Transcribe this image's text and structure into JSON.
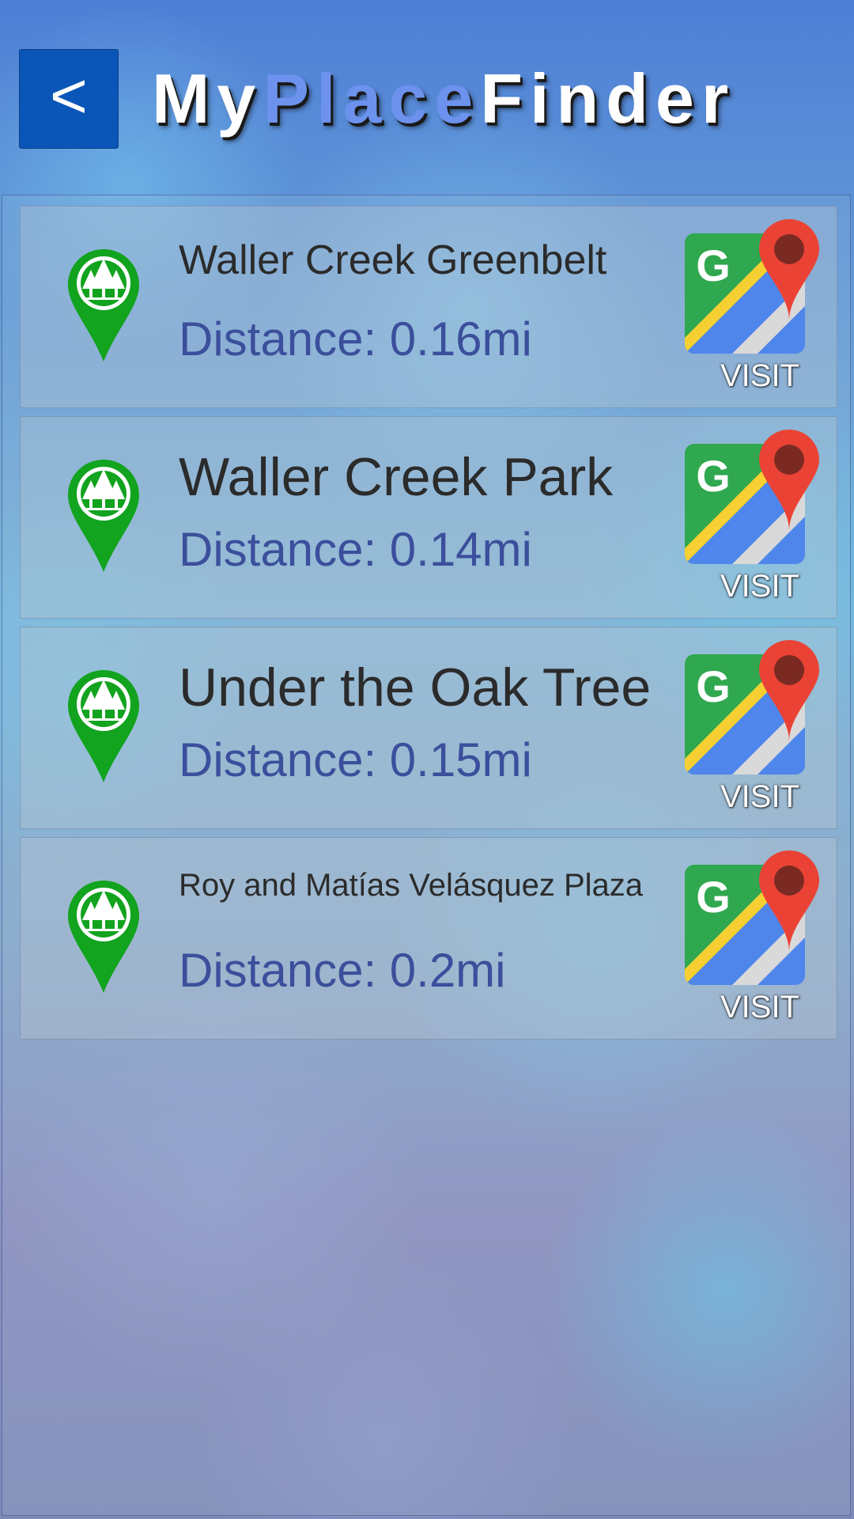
{
  "header": {
    "back_label": "<",
    "title_parts": [
      "My",
      "Place",
      "Finder"
    ]
  },
  "colors": {
    "back_button": "#0a56b8",
    "title_accent": "#6c92ee",
    "pin_green": "#12a31f",
    "distance_text": "#3b4f9c"
  },
  "places": [
    {
      "name": "Waller Creek Greenbelt",
      "distance": "Distance: 0.16mi",
      "visit_label": "VISIT",
      "icon": "park-pin-icon"
    },
    {
      "name": "Waller Creek Park",
      "distance": "Distance: 0.14mi",
      "visit_label": "VISIT",
      "icon": "park-pin-icon"
    },
    {
      "name": "Under the Oak Tree",
      "distance": "Distance: 0.15mi",
      "visit_label": "VISIT",
      "icon": "park-pin-icon"
    },
    {
      "name": "Roy and Matías Velásquez Plaza",
      "distance": "Distance: 0.2mi",
      "visit_label": "VISIT",
      "icon": "park-pin-icon"
    }
  ]
}
